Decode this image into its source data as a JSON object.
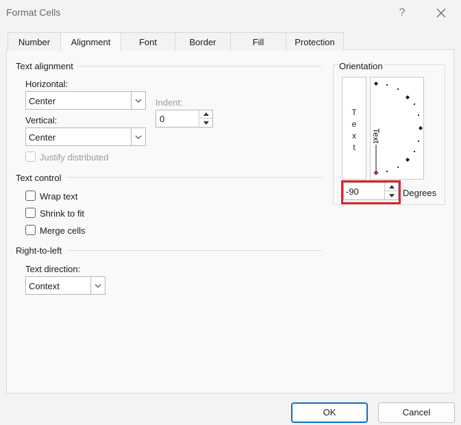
{
  "window": {
    "title": "Format Cells",
    "help_label": "?"
  },
  "tabs": [
    {
      "label": "Number",
      "active": false
    },
    {
      "label": "Alignment",
      "active": true
    },
    {
      "label": "Font",
      "active": false
    },
    {
      "label": "Border",
      "active": false
    },
    {
      "label": "Fill",
      "active": false
    },
    {
      "label": "Protection",
      "active": false
    }
  ],
  "text_alignment": {
    "group_label": "Text alignment",
    "horizontal_label": "Horizontal:",
    "horizontal_value": "Center",
    "vertical_label": "Vertical:",
    "vertical_value": "Center",
    "indent_label": "Indent:",
    "indent_value": "0",
    "justify_distributed_label": "Justify distributed"
  },
  "text_control": {
    "group_label": "Text control",
    "wrap_text": {
      "label": "Wrap text",
      "checked": false
    },
    "shrink_to_fit": {
      "label": "Shrink to fit",
      "checked": false
    },
    "merge_cells": {
      "label": "Merge cells",
      "checked": false
    }
  },
  "right_to_left": {
    "group_label": "Right-to-left",
    "direction_label": "Text direction:",
    "direction_value": "Context"
  },
  "orientation": {
    "group_label": "Orientation",
    "vertical_text_letters": [
      "T",
      "e",
      "x",
      "t"
    ],
    "dial_text": "Text",
    "degrees_value": "-90",
    "degrees_label": "Degrees"
  },
  "footer": {
    "ok_label": "OK",
    "cancel_label": "Cancel"
  },
  "colors": {
    "accent": "#0f6cbd",
    "highlight": "#e02424",
    "dial_marker": "#d13438"
  }
}
